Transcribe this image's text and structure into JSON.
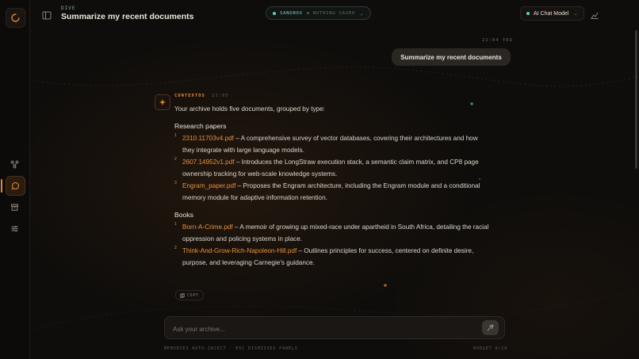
{
  "header": {
    "breadcrumb": "DIVE",
    "title": "Summarize my recent documents",
    "sandbox_label": "SANDBOX",
    "saved_status": "NOTHING SAVED",
    "model_label": "AI Chat Model"
  },
  "conversation": {
    "user_time": "21:04 YOU",
    "user_message": "Summarize my recent documents",
    "agent_name": "CONTEXTOS",
    "agent_time": "21:05",
    "intro": "Your archive holds five documents, grouped by type:",
    "sections": [
      {
        "heading": "Research papers",
        "items": [
          {
            "num": "1",
            "file": "2310.11703v4.pdf",
            "desc": " – A comprehensive survey of vector databases, covering their architectures and how they integrate with large language models."
          },
          {
            "num": "2",
            "file": "2607.14952v1.pdf",
            "desc": " – Introduces the LongStraw execution stack, a semantic claim matrix, and CP8 page ownership tracking for web-scale knowledge systems."
          },
          {
            "num": "3",
            "file": "Engram_paper.pdf",
            "desc": " – Proposes the Engram architecture, including the Engram module and a conditional memory module for adaptive information retention."
          }
        ]
      },
      {
        "heading": "Books",
        "items": [
          {
            "num": "1",
            "file": "Born-A-Crime.pdf",
            "desc": " – A memoir of growing up mixed-race under apartheid in South Africa, detailing the racial oppression and policing systems in place."
          },
          {
            "num": "2",
            "file": "Think-And-Grow-Rich-Napoleon-Hill.pdf",
            "desc": " – Outlines principles for success, centered on definite desire, purpose, and leveraging Carnegie's guidance."
          }
        ]
      }
    ],
    "copy_label": "COPY"
  },
  "composer": {
    "placeholder": "Ask your archive...",
    "hint_left": "MEMORIES AUTO-INJECT · ESC DISMISSES PANELS",
    "budget": "BUDGET 0/20"
  },
  "colors": {
    "accent": "#e8913a",
    "sandbox": "#5fd0b8",
    "background": "#0f0d0b"
  },
  "icons": [
    "logo-icon",
    "panel-toggle-icon",
    "network-icon",
    "chat-icon",
    "archive-icon",
    "sliders-icon",
    "chevron-down-icon",
    "chart-icon",
    "sparkle-icon",
    "copy-icon",
    "send-icon"
  ]
}
